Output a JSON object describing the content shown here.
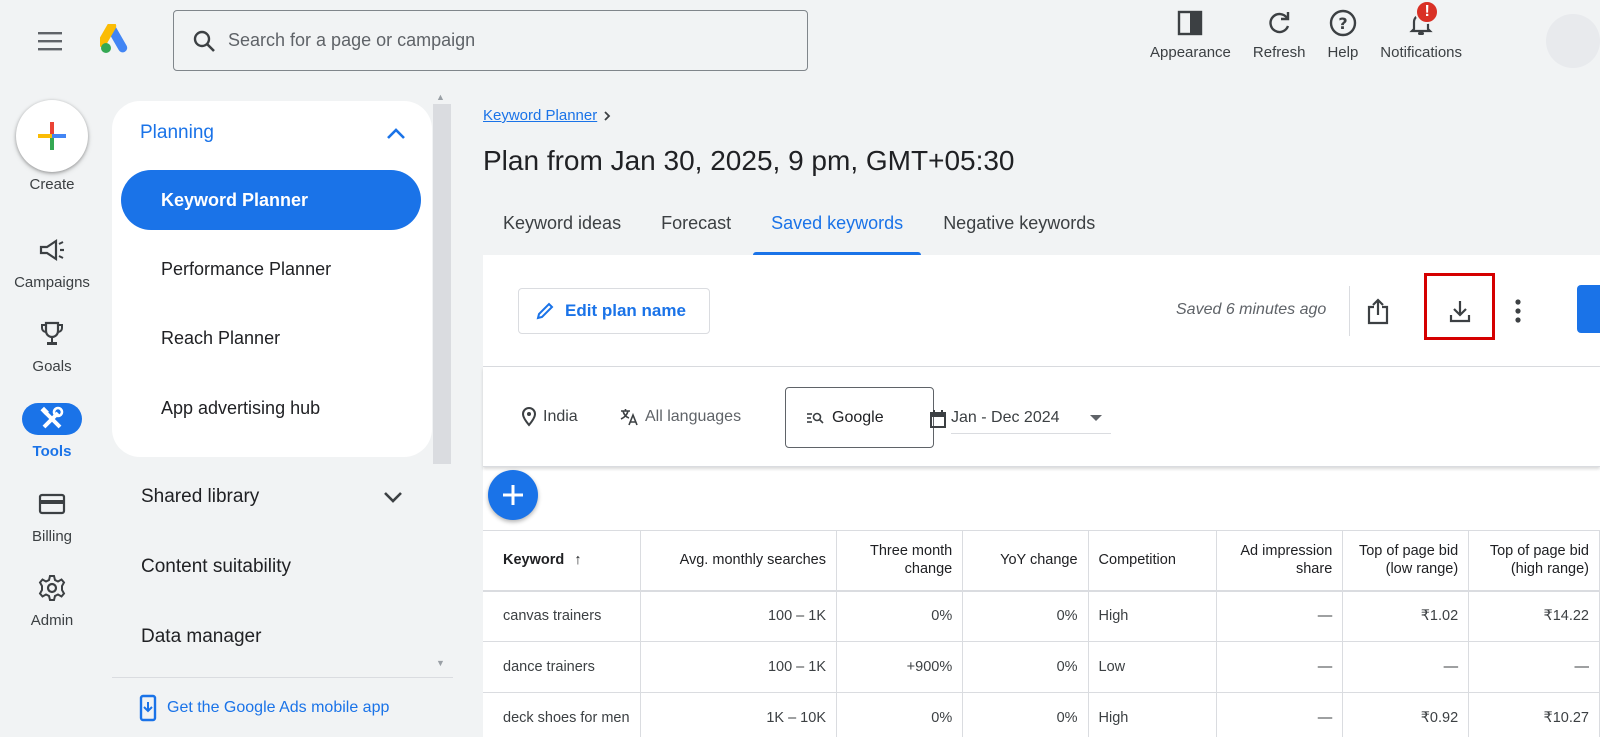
{
  "search": {
    "placeholder": "Search for a page or campaign"
  },
  "top_actions": [
    {
      "label": "Appearance",
      "icon": "appearance-icon"
    },
    {
      "label": "Refresh",
      "icon": "refresh-icon"
    },
    {
      "label": "Help",
      "icon": "help-icon"
    },
    {
      "label": "Notifications",
      "icon": "bell-icon",
      "badge": "!"
    }
  ],
  "rail": {
    "create_label": "Create",
    "items": [
      {
        "label": "Campaigns",
        "icon": "megaphone-icon"
      },
      {
        "label": "Goals",
        "icon": "trophy-icon"
      },
      {
        "label": "Tools",
        "icon": "tools-icon",
        "active": true
      },
      {
        "label": "Billing",
        "icon": "credit-card-icon"
      },
      {
        "label": "Admin",
        "icon": "gear-icon"
      }
    ]
  },
  "nav": {
    "section_title": "Planning",
    "items": [
      "Keyword Planner",
      "Performance Planner",
      "Reach Planner",
      "App advertising hub"
    ],
    "sections": [
      "Shared library",
      "Content suitability",
      "Data manager"
    ],
    "mobile_app": "Get the Google Ads mobile app"
  },
  "breadcrumb": "Keyword Planner",
  "page_title": "Plan from Jan 30, 2025, 9 pm, GMT+05:30",
  "tabs": [
    "Keyword ideas",
    "Forecast",
    "Saved keywords",
    "Negative keywords"
  ],
  "active_tab": "Saved keywords",
  "toolbar": {
    "edit_label": "Edit plan name",
    "saved_text": "Saved 6 minutes ago"
  },
  "filters": {
    "location": "India",
    "language": "All languages",
    "network": "Google",
    "date_range": "Jan - Dec 2024"
  },
  "table": {
    "headers": [
      "Keyword",
      "Avg. monthly searches",
      "Three month change",
      "YoY change",
      "Competition",
      "Ad impression share",
      "Top of page bid (low range)",
      "Top of page bid (high range)"
    ],
    "rows": [
      [
        "canvas trainers",
        "100 – 1K",
        "0%",
        "0%",
        "High",
        "—",
        "₹1.02",
        "₹14.22"
      ],
      [
        "dance trainers",
        "100 – 1K",
        "+900%",
        "0%",
        "Low",
        "—",
        "—",
        "—"
      ],
      [
        "deck shoes for men",
        "1K – 10K",
        "0%",
        "0%",
        "High",
        "—",
        "₹0.92",
        "₹10.27"
      ]
    ]
  },
  "colors": {
    "accent": "#1a73e8",
    "highlight": "#d50000",
    "badge": "#d93025"
  }
}
